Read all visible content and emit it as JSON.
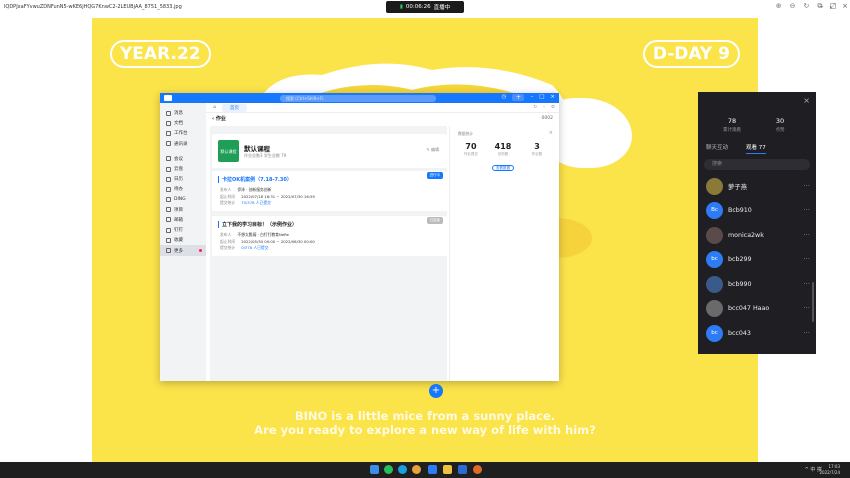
{
  "topbar": {
    "file_title": "lQDPJxaFYvwuZDNFunN5-wKE6jHQG7KnwC2-2LEUBjAA_8751_5833.jpg",
    "rec_time": "00:06:26",
    "rec_status": "直播中"
  },
  "poster": {
    "left_pill": "YEAR.22",
    "right_pill": "D-DAY 9",
    "caption_line1": "BINO is a little mice from a sunny place.",
    "caption_line2": "Are you ready to explore a new way of life with him?"
  },
  "app": {
    "search_placeholder": "搜索 (Ctrl+Shift+F)",
    "sidebar": [
      {
        "label": "消息"
      },
      {
        "label": "文档"
      },
      {
        "label": "工作台"
      },
      {
        "label": "通讯录"
      },
      {
        "label": "会议"
      },
      {
        "label": "云盘"
      },
      {
        "label": "日历"
      },
      {
        "label": "待办"
      },
      {
        "label": "DING"
      },
      {
        "label": "项目"
      },
      {
        "label": "邮箱"
      },
      {
        "label": "钉钉"
      },
      {
        "label": "收藏"
      },
      {
        "label": "更多"
      }
    ],
    "tab_label": "首页",
    "breadcrumb": "作业",
    "breadcrumb_more": "0002",
    "course": {
      "cover_text": "默认课程",
      "name": "默认课程",
      "meta": "作业总数3  学生总数 79",
      "edit": "编辑"
    },
    "cards": [
      {
        "title": "卡拉OK机案例（7.18-7.30）",
        "tag": "进行中",
        "rows": [
          {
            "k": "发布人",
            "v": "伊泽 · 创新服务创新"
          },
          {
            "k": "起止时间",
            "v": "2022/07/18 16:31 ~ 2022/07/30 16:59"
          },
          {
            "k": "提交统计",
            "v": "70/378 人已提交"
          }
        ]
      },
      {
        "title": "立下我的学习目标！（示例作业）",
        "tag": "已结束",
        "rows": [
          {
            "k": "发布人",
            "v": "不想太脆弱 · 白钉钉教育NeRe"
          },
          {
            "k": "起止时间",
            "v": "2022/05/30 00:00 ~ 2022/06/30 00:00"
          },
          {
            "k": "提交统计",
            "v": "0/378 人已提交"
          }
        ]
      }
    ],
    "stats": {
      "label": "数据统计",
      "items": [
        {
          "n": "70",
          "t": "作业提交"
        },
        {
          "n": "418",
          "t": "总份数"
        },
        {
          "n": "3",
          "t": "作业数"
        }
      ],
      "button": "查看数据"
    }
  },
  "panel": {
    "stat1_num": "78",
    "stat1_label": "累计观看",
    "stat2_num": "30",
    "stat2_label": "点赞",
    "tab_chat": "聊天互动",
    "tab_viewers": "观看 77",
    "search_placeholder": "搜索",
    "users": [
      {
        "name": "萝子燕",
        "initials": "",
        "color": "#8a7a3a"
      },
      {
        "name": "Bcb910",
        "initials": "Bc",
        "color": "#2d7cf6"
      },
      {
        "name": "monica2wk",
        "initials": "",
        "color": "#5a4a4a"
      },
      {
        "name": "bcb299",
        "initials": "bc",
        "color": "#2d7cf6"
      },
      {
        "name": "bcb990",
        "initials": "",
        "color": "#3a5a8a"
      },
      {
        "name": "bcc047 Haao",
        "initials": "",
        "color": "#6a6a6a"
      },
      {
        "name": "bcc043",
        "initials": "bc",
        "color": "#2d7cf6"
      }
    ]
  },
  "taskbar": {
    "tray": "^  中  拼",
    "time": "17:03",
    "date": "2022/7/24"
  }
}
